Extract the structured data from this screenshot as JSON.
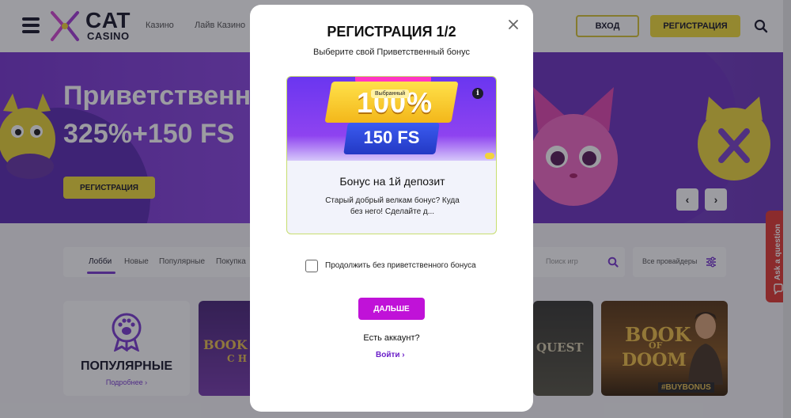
{
  "header": {
    "logo_cat": "CAT",
    "logo_casino": "CASINO",
    "nav": [
      "Казино",
      "Лайв Казино"
    ],
    "login_label": "ВХОД",
    "register_label": "РЕГИСТРАЦИЯ"
  },
  "hero": {
    "title": "Приветственны",
    "subtitle": "325%+150 FS",
    "button_label": "РЕГИСТРАЦИЯ",
    "prev_glyph": "‹",
    "next_glyph": "›"
  },
  "filters": {
    "tabs": [
      "Лобби",
      "Новые",
      "Популярные",
      "Покупка"
    ],
    "search_placeholder": "Поиск игр",
    "provider_label": "Все провайдеры"
  },
  "popular": {
    "title": "ПОПУЛЯРНЫЕ",
    "more": "Подробнее ›"
  },
  "games": {
    "tile1_text": "BOOK",
    "tile1_sub": "C H",
    "tile2_text": "QUEST",
    "tile3_line1": "BOOK",
    "tile3_line2": "OF",
    "tile3_line3": "DOOM",
    "tile3_badge": "#BUYBONUS"
  },
  "support": {
    "label": "Ask a question"
  },
  "modal": {
    "title": "РЕГИСТРАЦИЯ 1/2",
    "subtitle": "Выберите свой Приветственный бонус",
    "bonus": {
      "percent": "100%",
      "badge": "Выбранный",
      "info": "i",
      "free_spins": "150 FS",
      "name": "Бонус на 1й депозит",
      "description": "Старый добрый велкам бонус? Куда без него! Сделайте д..."
    },
    "checkbox_label": "Продолжить без приветственного бонуса",
    "checkbox_checked": false,
    "next_label": "ДАЛЬШЕ",
    "have_account": "Есть аккаунт?",
    "login_label": "Войти ›"
  },
  "colors": {
    "accent_yellow": "#f1dd3d",
    "accent_purple": "#7c3fd1",
    "next_button": "#c012d8",
    "support_red": "#e23d36"
  }
}
